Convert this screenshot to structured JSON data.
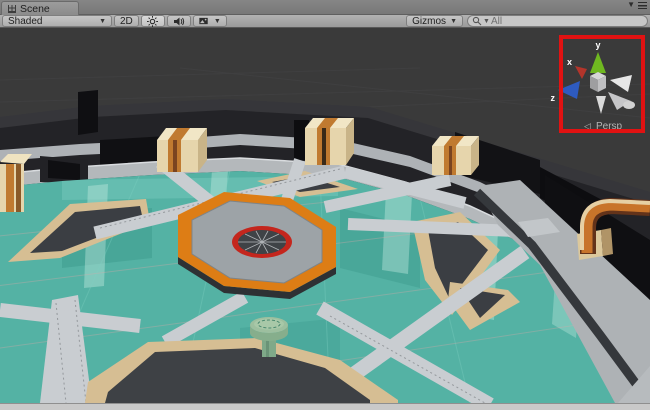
{
  "window": {
    "tab_label": "Scene"
  },
  "toolbar": {
    "shading_dropdown": "Shaded",
    "toggle_2d": "2D",
    "gizmos_dropdown": "Gizmos",
    "search": {
      "placeholder": "All"
    }
  },
  "viewport": {
    "gizmo": {
      "axis_x": "x",
      "axis_y": "y",
      "axis_z": "z",
      "projection": "Persp"
    },
    "annotation_color": "#e11212"
  },
  "colors": {
    "editor_background": "#3a3a3a",
    "floor_teal": "#54b2a4",
    "platform_orange": "#dd7d15",
    "target_red": "#c4261d",
    "panel_tan": "#d6be93",
    "beam_gray": "#c9cdd1",
    "axis_x_red": "#b3352b",
    "axis_y_green": "#6fb820",
    "axis_z_blue": "#2e5bc0"
  }
}
